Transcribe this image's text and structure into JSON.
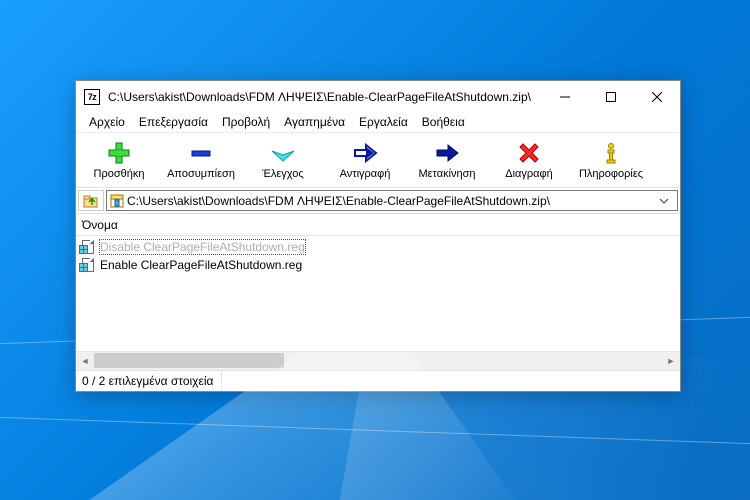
{
  "app_icon_text": "7z",
  "window_title": "C:\\Users\\akist\\Downloads\\FDM ΛΗΨΕΙΣ\\Enable-ClearPageFileAtShutdown.zip\\",
  "menu": {
    "file": "Αρχείο",
    "edit": "Επεξεργασία",
    "view": "Προβολή",
    "favorites": "Αγαπημένα",
    "tools": "Εργαλεία",
    "help": "Βοήθεια"
  },
  "toolbar": {
    "add": "Προσθήκη",
    "extract": "Αποσυμπίεση",
    "test": "Έλεγχος",
    "copy": "Αντιγραφή",
    "move": "Μετακίνηση",
    "delete": "Διαγραφή",
    "info": "Πληροφορίες"
  },
  "path": "C:\\Users\\akist\\Downloads\\FDM ΛΗΨΕΙΣ\\Enable-ClearPageFileAtShutdown.zip\\",
  "list": {
    "header_name": "Όνομα",
    "files": [
      {
        "name": "Disable ClearPageFileAtShutdown.reg",
        "selected": true
      },
      {
        "name": "Enable ClearPageFileAtShutdown.reg",
        "selected": false
      }
    ]
  },
  "status": {
    "selection": "0 / 2 επιλεγμένα στοιχεία"
  }
}
